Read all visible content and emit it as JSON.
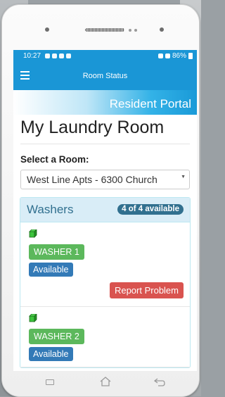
{
  "status_bar": {
    "time": "10:27",
    "battery": "86%"
  },
  "app_bar": {
    "title": "Room Status"
  },
  "banner": {
    "text": "Resident Portal"
  },
  "page": {
    "title": "My Laundry Room",
    "select_label": "Select a Room:",
    "selected_room": "West Line Apts - 6300 Church"
  },
  "washers": {
    "title": "Washers",
    "available_badge": "4 of 4 available",
    "machines": [
      {
        "name": "WASHER 1",
        "status": "Available",
        "report_label": "Report Problem"
      },
      {
        "name": "WASHER 2",
        "status": "Available"
      }
    ]
  },
  "colors": {
    "primary": "#1a96d6",
    "success": "#5cb85c",
    "status_blue": "#337ab7",
    "danger": "#d9534f",
    "panel_heading": "#d9edf7"
  }
}
